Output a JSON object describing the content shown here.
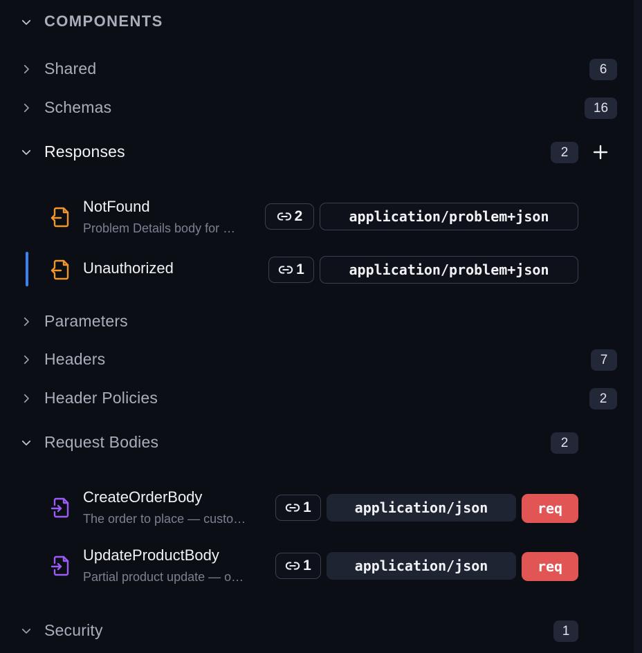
{
  "section": {
    "title": "COMPONENTS"
  },
  "groups": {
    "shared": {
      "label": "Shared",
      "count": "6"
    },
    "schemas": {
      "label": "Schemas",
      "count": "16"
    },
    "responses": {
      "label": "Responses",
      "count": "2",
      "items": [
        {
          "name": "NotFound",
          "desc": "Problem Details body for …",
          "refs": "2",
          "mime": "application/problem+json"
        },
        {
          "name": "Unauthorized",
          "desc": "",
          "refs": "1",
          "mime": "application/problem+json"
        }
      ]
    },
    "parameters": {
      "label": "Parameters"
    },
    "headers": {
      "label": "Headers",
      "count": "7"
    },
    "header_policies": {
      "label": "Header Policies",
      "count": "2"
    },
    "request_bodies": {
      "label": "Request Bodies",
      "count": "2",
      "items": [
        {
          "name": "CreateOrderBody",
          "desc": "The order to place — custo…",
          "refs": "1",
          "mime": "application/json",
          "badge": "req"
        },
        {
          "name": "UpdateProductBody",
          "desc": "Partial product update — o…",
          "refs": "1",
          "mime": "application/json",
          "badge": "req"
        }
      ]
    },
    "security": {
      "label": "Security",
      "count": "1"
    }
  },
  "colors": {
    "accent": "#3b82f6",
    "response_icon": "#f0962e",
    "request_icon": "#9b5cf6",
    "req_badge": "#e25555",
    "background": "#0b0e15"
  },
  "icons": {
    "expanded": "chevron-down-icon",
    "collapsed": "chevron-right-icon",
    "add": "plus-icon",
    "refs": "link-icon",
    "response": "file-export-icon",
    "request": "file-import-icon"
  }
}
